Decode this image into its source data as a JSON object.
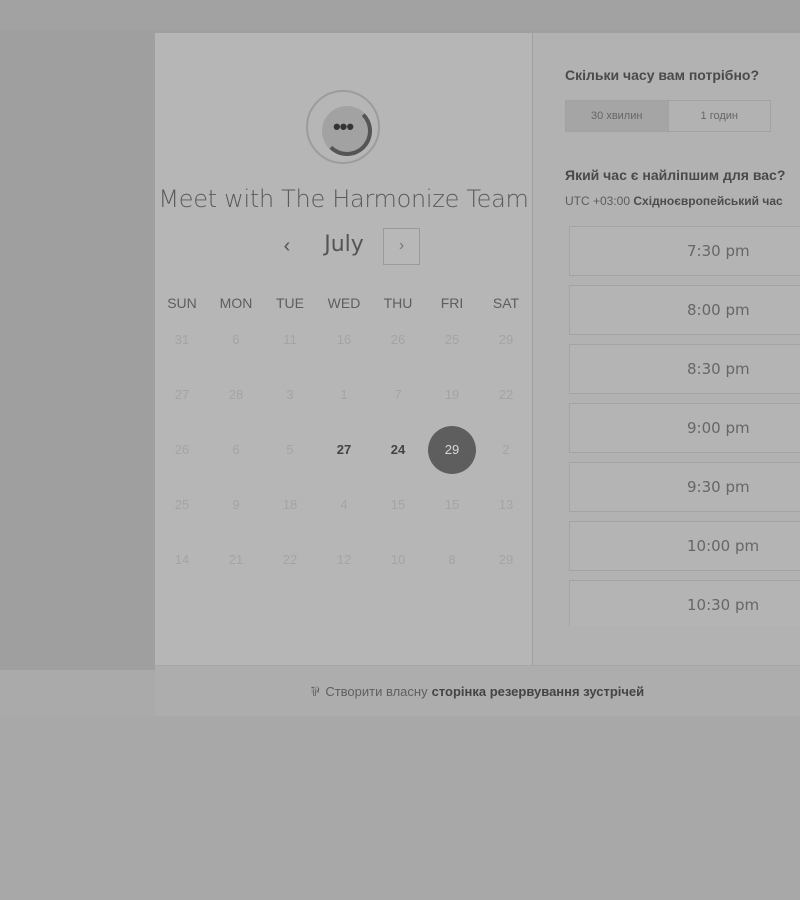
{
  "page": {
    "title": "Meet with The Harmonize Team",
    "month": "July",
    "prev_icon": "‹",
    "next_icon": "›"
  },
  "weekdays": [
    "SUN",
    "MON",
    "TUE",
    "WED",
    "THU",
    "FRI",
    "SAT"
  ],
  "calendar": {
    "rows": [
      [
        {
          "d": "31",
          "s": "dim"
        },
        {
          "d": "6",
          "s": "dim"
        },
        {
          "d": "11",
          "s": "dim"
        },
        {
          "d": "16",
          "s": "dim"
        },
        {
          "d": "26",
          "s": "dim"
        },
        {
          "d": "25",
          "s": "dim"
        },
        {
          "d": "29",
          "s": "dim"
        }
      ],
      [
        {
          "d": "27",
          "s": "dim"
        },
        {
          "d": "28",
          "s": "dim"
        },
        {
          "d": "3",
          "s": "dim"
        },
        {
          "d": "1",
          "s": "dim"
        },
        {
          "d": "7",
          "s": "dim"
        },
        {
          "d": "19",
          "s": "dim"
        },
        {
          "d": "22",
          "s": "dim"
        }
      ],
      [
        {
          "d": "26",
          "s": "dim"
        },
        {
          "d": "6",
          "s": "dim"
        },
        {
          "d": "5",
          "s": "dim"
        },
        {
          "d": "27",
          "s": "avail"
        },
        {
          "d": "24",
          "s": "avail"
        },
        {
          "d": "29",
          "s": "selected"
        },
        {
          "d": "2",
          "s": "dim"
        }
      ],
      [
        {
          "d": "25",
          "s": "dim"
        },
        {
          "d": "9",
          "s": "dim"
        },
        {
          "d": "18",
          "s": "dim"
        },
        {
          "d": "4",
          "s": "dim"
        },
        {
          "d": "15",
          "s": "dim"
        },
        {
          "d": "15",
          "s": "dim"
        },
        {
          "d": "13",
          "s": "dim"
        }
      ],
      [
        {
          "d": "14",
          "s": "dim"
        },
        {
          "d": "21",
          "s": "dim"
        },
        {
          "d": "22",
          "s": "dim"
        },
        {
          "d": "12",
          "s": "dim"
        },
        {
          "d": "10",
          "s": "dim"
        },
        {
          "d": "8",
          "s": "dim"
        },
        {
          "d": "29",
          "s": "dim"
        }
      ]
    ]
  },
  "booking": {
    "duration_question": "Скільки часу вам потрібно?",
    "durations": [
      {
        "label": "30 хвилин",
        "active": true
      },
      {
        "label": "1 годин",
        "active": false
      }
    ],
    "time_question": "Який час є найліпшим для вас?",
    "timezone_prefix": "UTC +03:00",
    "timezone_name": "Східноєвропейський час",
    "slots": [
      "7:30 pm",
      "8:00 pm",
      "8:30 pm",
      "9:00 pm",
      "9:30 pm",
      "10:00 pm",
      "10:30 pm"
    ]
  },
  "footer": {
    "icon": "⅌",
    "text": "Створити власну",
    "link": "сторінка резервування зустрічей"
  }
}
